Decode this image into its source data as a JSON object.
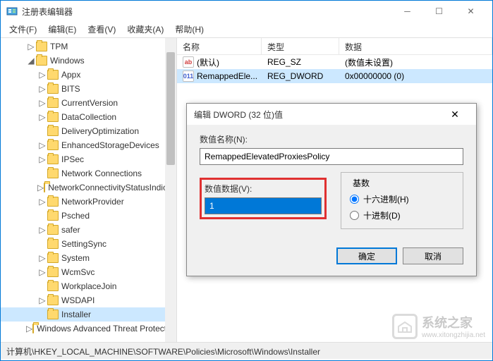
{
  "window": {
    "title": "注册表编辑器"
  },
  "menu": {
    "file": "文件(F)",
    "edit": "编辑(E)",
    "view": "查看(V)",
    "favorites": "收藏夹(A)",
    "help": "帮助(H)"
  },
  "tree": {
    "items": [
      {
        "label": "TPM",
        "indent": 2,
        "expand": "▷"
      },
      {
        "label": "Windows",
        "indent": 2,
        "expand": "◢"
      },
      {
        "label": "Appx",
        "indent": 3,
        "expand": "▷"
      },
      {
        "label": "BITS",
        "indent": 3,
        "expand": "▷"
      },
      {
        "label": "CurrentVersion",
        "indent": 3,
        "expand": "▷"
      },
      {
        "label": "DataCollection",
        "indent": 3,
        "expand": "▷"
      },
      {
        "label": "DeliveryOptimization",
        "indent": 3,
        "expand": ""
      },
      {
        "label": "EnhancedStorageDevices",
        "indent": 3,
        "expand": "▷"
      },
      {
        "label": "IPSec",
        "indent": 3,
        "expand": "▷"
      },
      {
        "label": "Network Connections",
        "indent": 3,
        "expand": ""
      },
      {
        "label": "NetworkConnectivityStatusIndicator",
        "indent": 3,
        "expand": "▷"
      },
      {
        "label": "NetworkProvider",
        "indent": 3,
        "expand": "▷"
      },
      {
        "label": "Psched",
        "indent": 3,
        "expand": ""
      },
      {
        "label": "safer",
        "indent": 3,
        "expand": "▷"
      },
      {
        "label": "SettingSync",
        "indent": 3,
        "expand": ""
      },
      {
        "label": "System",
        "indent": 3,
        "expand": "▷"
      },
      {
        "label": "WcmSvc",
        "indent": 3,
        "expand": "▷"
      },
      {
        "label": "WorkplaceJoin",
        "indent": 3,
        "expand": ""
      },
      {
        "label": "WSDAPI",
        "indent": 3,
        "expand": "▷"
      },
      {
        "label": "Installer",
        "indent": 3,
        "expand": "",
        "selected": true
      },
      {
        "label": "Windows Advanced Threat Protection",
        "indent": 2,
        "expand": "▷"
      }
    ]
  },
  "list": {
    "columns": {
      "name": "名称",
      "type": "类型",
      "data": "数据"
    },
    "rows": [
      {
        "icon": "sz",
        "icon_text": "ab",
        "name": "(默认)",
        "type": "REG_SZ",
        "data": "(数值未设置)",
        "selected": false
      },
      {
        "icon": "dword",
        "icon_text": "011",
        "name": "RemappedEle...",
        "type": "REG_DWORD",
        "data": "0x00000000 (0)",
        "selected": true
      }
    ]
  },
  "statusbar": {
    "path": "计算机\\HKEY_LOCAL_MACHINE\\SOFTWARE\\Policies\\Microsoft\\Windows\\Installer"
  },
  "dialog": {
    "title": "编辑 DWORD (32 位)值",
    "name_label": "数值名称(N):",
    "name_value": "RemappedElevatedProxiesPolicy",
    "data_label": "数值数据(V):",
    "data_value": "1",
    "radix_label": "基数",
    "radix_hex": "十六进制(H)",
    "radix_dec": "十进制(D)",
    "ok": "确定",
    "cancel": "取消"
  },
  "watermark": {
    "cn": "系统之家",
    "url": "www.xitongzhijia.net"
  }
}
